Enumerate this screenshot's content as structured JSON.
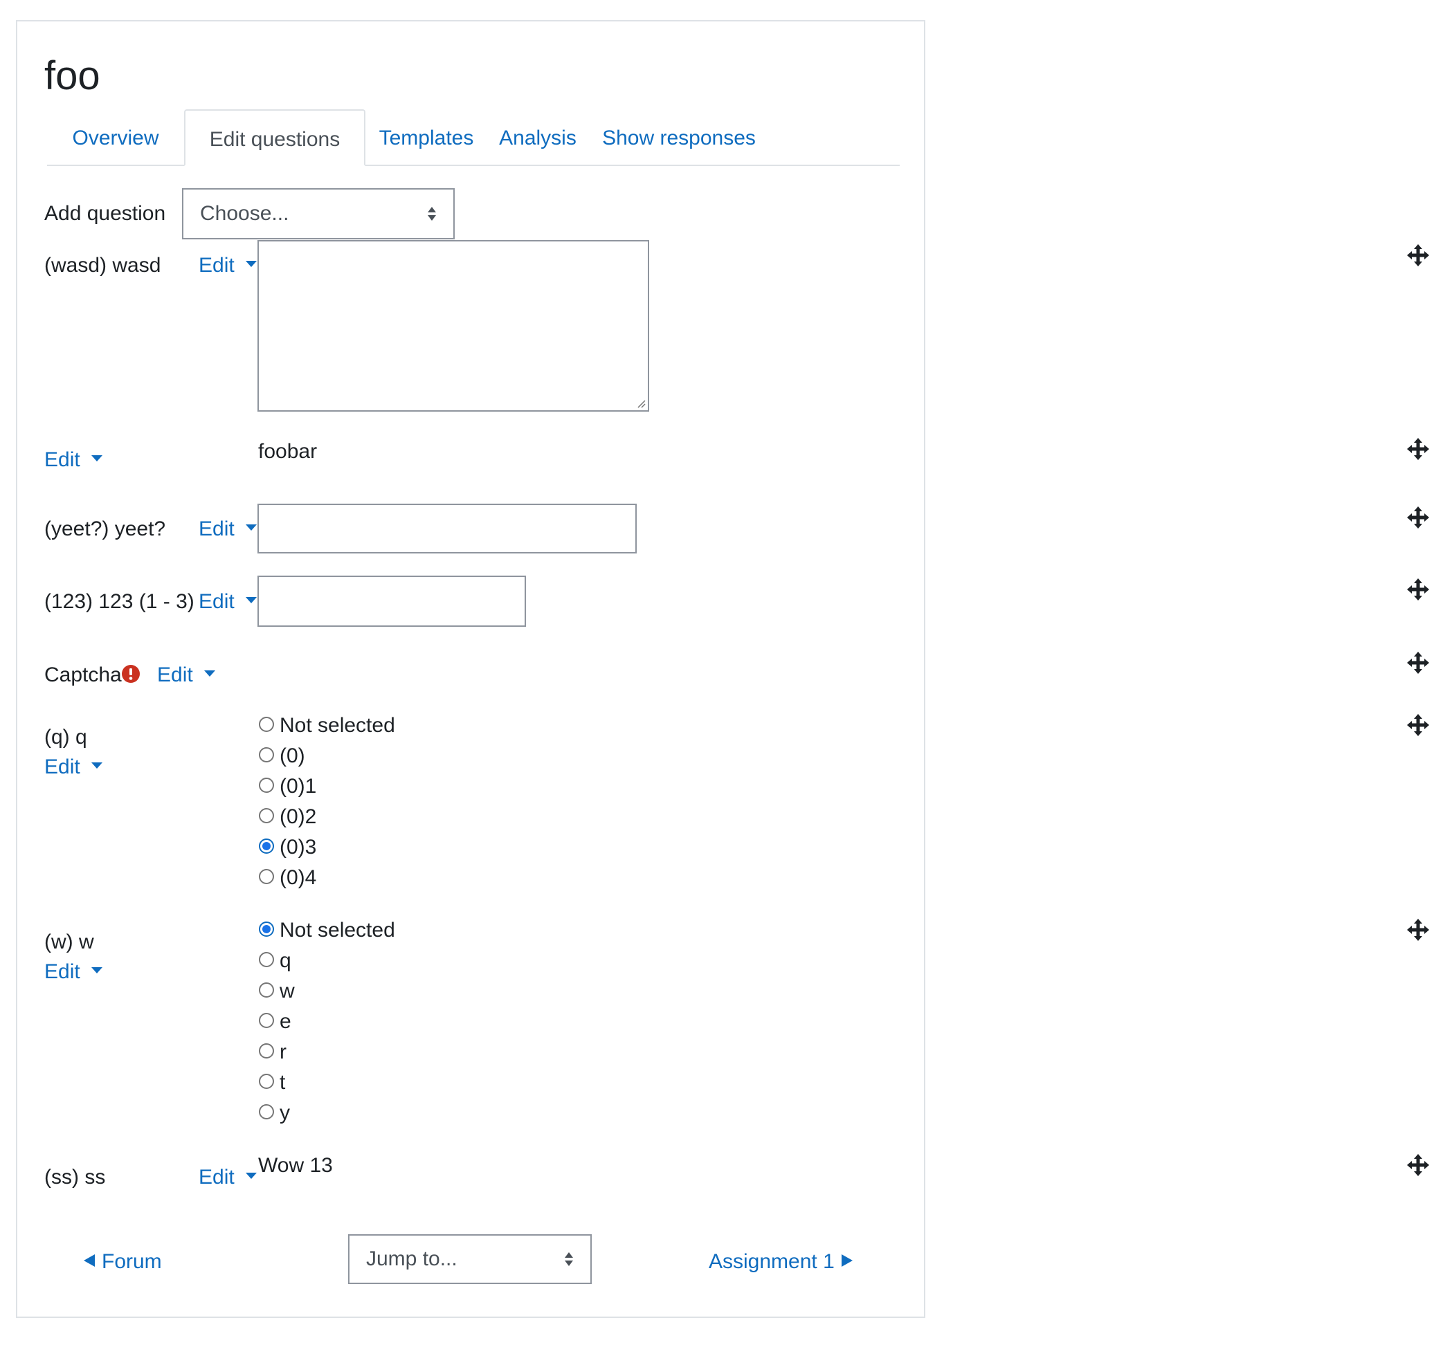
{
  "page": {
    "title": "foo"
  },
  "tabs": [
    {
      "label": "Overview",
      "active": false
    },
    {
      "label": "Edit questions",
      "active": true
    },
    {
      "label": "Templates",
      "active": false
    },
    {
      "label": "Analysis",
      "active": false
    },
    {
      "label": "Show responses",
      "active": false
    }
  ],
  "add_question": {
    "label": "Add question",
    "selected": "Choose..."
  },
  "edit_label": "Edit",
  "questions": {
    "wasd": {
      "label": "(wasd) wasd"
    },
    "foobar": {
      "text": "foobar"
    },
    "yeet": {
      "label": "(yeet?) yeet?"
    },
    "num": {
      "label": "(123) 123 (1 - 3)"
    },
    "captcha": {
      "label": "Captcha"
    },
    "q": {
      "label": "(q) q",
      "options": [
        "Not selected",
        "(0)",
        "(0)1",
        "(0)2",
        "(0)3",
        "(0)4"
      ],
      "selected": "(0)3"
    },
    "w": {
      "label": "(w) w",
      "options": [
        "Not selected",
        "q",
        "w",
        "e",
        "r",
        "t",
        "y"
      ],
      "selected": "Not selected"
    },
    "ss": {
      "label": "(ss) ss",
      "text": "Wow 13"
    }
  },
  "footer": {
    "prev": "Forum",
    "jump": "Jump to...",
    "next": "Assignment 1"
  },
  "colors": {
    "link": "#0f6cbf",
    "text": "#1d2125",
    "border": "#8f959e",
    "alert": "#ca3120",
    "radio_checked": "#1a73e8"
  },
  "icons": {
    "move": "move-icon",
    "alert": "exclamation-circle-icon",
    "caret": "caret-down-icon"
  }
}
